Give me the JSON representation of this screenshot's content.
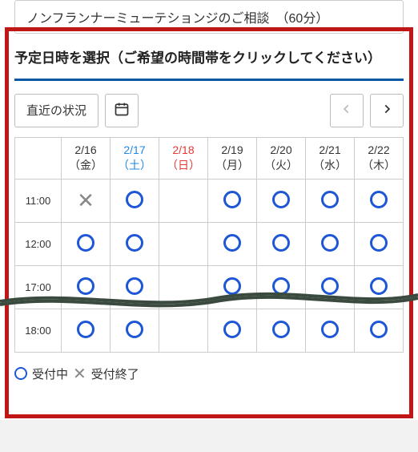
{
  "top_item_label": "ノンフランナーミューテションジのご相談　（60分）",
  "section_title": "予定日時を選択（ご希望の時間帯をクリックしてください）",
  "toolbar": {
    "recent_label": "直近の状況"
  },
  "days": [
    {
      "date": "2/16",
      "dow": "（金）",
      "cls": ""
    },
    {
      "date": "2/17",
      "dow": "（土）",
      "cls": "sat"
    },
    {
      "date": "2/18",
      "dow": "（日）",
      "cls": "sun"
    },
    {
      "date": "2/19",
      "dow": "（月）",
      "cls": ""
    },
    {
      "date": "2/20",
      "dow": "（火）",
      "cls": ""
    },
    {
      "date": "2/21",
      "dow": "（水）",
      "cls": ""
    },
    {
      "date": "2/22",
      "dow": "（木）",
      "cls": ""
    }
  ],
  "rows": [
    {
      "time": "11:00",
      "slots": [
        "closed",
        "open",
        "blocked",
        "open",
        "open",
        "open",
        "open"
      ]
    },
    {
      "time": "12:00",
      "slots": [
        "open",
        "open",
        "blocked",
        "open",
        "open",
        "open",
        "open"
      ]
    },
    {
      "time": "17:00",
      "slots": [
        "open",
        "open",
        "blocked",
        "open",
        "open",
        "open",
        "open"
      ]
    },
    {
      "time": "18:00",
      "slots": [
        "open",
        "open",
        "blocked",
        "open",
        "open",
        "open",
        "open"
      ]
    }
  ],
  "legend": {
    "open": "受付中",
    "closed": "受付終了"
  },
  "colors": {
    "accent": "#0a57a3",
    "open_circle": "#1e57d6",
    "frame": "#c11616",
    "saturday": "#1e88e5",
    "sunday": "#e53935"
  }
}
